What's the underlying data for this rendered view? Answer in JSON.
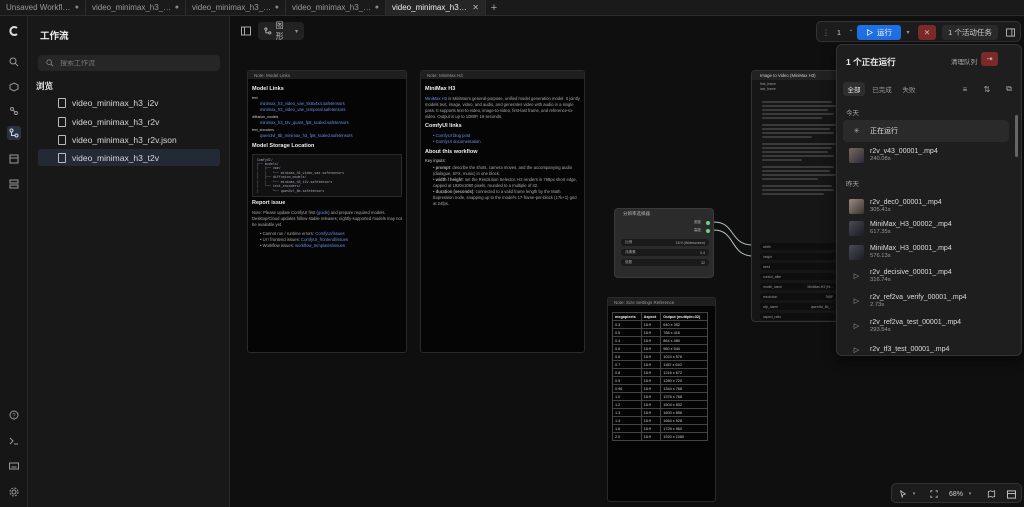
{
  "tabs": [
    {
      "label": "Unsaved Workflow",
      "dot": true
    },
    {
      "label": "video_minimax_h3_r…",
      "dot": true
    },
    {
      "label": "video_minimax_h3_i…",
      "dot": true
    },
    {
      "label": "video_minimax_h3_r…",
      "dot": true
    },
    {
      "label": "video_minimax_h3_t…",
      "active": true
    },
    {
      "label": "+"
    }
  ],
  "sidebar": {
    "title": "工作流",
    "search_placeholder": "搜索工作流",
    "section": "浏览",
    "items": [
      {
        "label": "video_minimax_h3_i2v"
      },
      {
        "label": "video_minimax_h3_r2v"
      },
      {
        "label": "video_minimax_h3_r2v.json"
      },
      {
        "label": "video_minimax_h3_t2v",
        "selected": true
      }
    ]
  },
  "canvas": {
    "graph_button": "图形",
    "note_links": {
      "header": "Note: Model Links",
      "title": "Model Links",
      "storage_title": "Model Storage Location",
      "report_title": "Report issue"
    },
    "note_h3": {
      "header": "Note: MiniMax H3",
      "title": "MiniMax H3",
      "links_title": "ComfyUI links",
      "about_title": "About this workflow",
      "key_inputs": "Key inputs:"
    },
    "size_ref": {
      "header": "Note: Size Settings Reference",
      "columns": [
        "megapixels",
        "Aspect",
        "Output (multiple=32)"
      ],
      "rows": [
        [
          "0.3",
          "16:9",
          "640 x 352"
        ],
        [
          "0.5",
          "16:9",
          "768 x 416"
        ],
        [
          "0.4",
          "16:9",
          "864 x 480"
        ],
        [
          "0.6",
          "16:9",
          "960 x 544"
        ],
        [
          "0.6",
          "16:9",
          "1024 x 576"
        ],
        [
          "0.7",
          "16:9",
          "1152 x 640"
        ],
        [
          "0.8",
          "16:9",
          "1216 x 672"
        ],
        [
          "0.9",
          "16:9",
          "1280 x 720"
        ],
        [
          "0.96",
          "16:9",
          "1344 x 768"
        ],
        [
          "1.0",
          "16:9",
          "1376 x 768"
        ],
        [
          "1.2",
          "16:9",
          "1504 x 832"
        ],
        [
          "1.3",
          "16:9",
          "1600 x 896"
        ],
        [
          "1.4",
          "16:9",
          "1664 x 928"
        ],
        [
          "1.6",
          "16:9",
          "1728 x 960"
        ],
        [
          "2.0",
          "16:9",
          "1920 x 1080"
        ]
      ]
    },
    "resolution_node": {
      "title": "分辨率选择器",
      "out1": "宽度",
      "out2": "高度",
      "row1_label": "比例",
      "row1_value": "16:9 (Widescreen)",
      "row2_label": "兆像素",
      "row2_value": "0.4",
      "row3_label": "倍数",
      "row3_value": "32"
    },
    "video_node": {
      "title": "Image to Video (MiniMax H3)",
      "in1": "first_frame",
      "in2": "last_frame",
      "widgets": [
        {
          "label": "width",
          "value": ""
        },
        {
          "label": "height",
          "value": ""
        },
        {
          "label": "seed",
          "value": ""
        },
        {
          "label": "control_after",
          "value": ""
        },
        {
          "label": "model_name",
          "value": "MiniMax-H3 (Hi..."
        },
        {
          "label": "resolution",
          "value": "768P"
        },
        {
          "label": "clip_name",
          "value": "qwen3vl_8b_..."
        },
        {
          "label": "aspect_ratio",
          "value": ""
        },
        {
          "label": "aspect_ratio",
          "value": ""
        }
      ]
    }
  },
  "top_controls": {
    "count": "1",
    "run_label": "运行",
    "active_tasks": "1 个活动任务"
  },
  "queue": {
    "title": "1 个正在运行",
    "clear_label": "清理队列",
    "filters": [
      "全部",
      "已完成",
      "失败"
    ],
    "today_label": "今天",
    "yesterday_label": "昨天",
    "items": [
      {
        "name": "正在运行",
        "time": "",
        "kind": "running"
      },
      {
        "name": "r2v_v43_00001_.mp4",
        "time": "240.08s",
        "kind": "thumb-a"
      },
      {
        "name": "r2v_dec0_00001_.mp4",
        "time": "305.41s",
        "kind": "thumb-c"
      },
      {
        "name": "MiniMax_H3_00002_.mp4",
        "time": "617.35s",
        "kind": "thumb-b"
      },
      {
        "name": "MiniMax_H3_00001_.mp4",
        "time": "576.13s",
        "kind": "thumb-b"
      },
      {
        "name": "r2v_decisive_00001_.mp4",
        "time": "316.74s",
        "kind": "play"
      },
      {
        "name": "r2v_ref2va_verify_00001_.mp4",
        "time": "2.73s",
        "kind": "play"
      },
      {
        "name": "r2v_ref2va_test_00001_.mp4",
        "time": "293.54s",
        "kind": "play"
      },
      {
        "name": "r2v_tf3_test_00001_.mp4",
        "time": "",
        "kind": "play"
      }
    ]
  },
  "bottom_controls": {
    "zoom": "68%"
  }
}
